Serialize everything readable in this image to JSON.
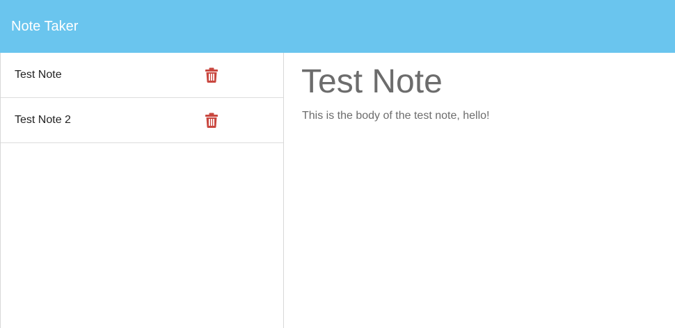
{
  "header": {
    "title": "Note Taker",
    "background": "#6ac5ee"
  },
  "sidebar": {
    "notes": [
      {
        "title": "Test Note",
        "delete_icon": "trash-icon"
      },
      {
        "title": "Test Note 2",
        "delete_icon": "trash-icon"
      }
    ]
  },
  "active_note": {
    "title": "Test Note",
    "body": "This is the body of the test note, hello!"
  },
  "colors": {
    "delete_icon": "#c9473f",
    "text_muted": "#6c6c6c",
    "divider": "#dcdcdc"
  }
}
